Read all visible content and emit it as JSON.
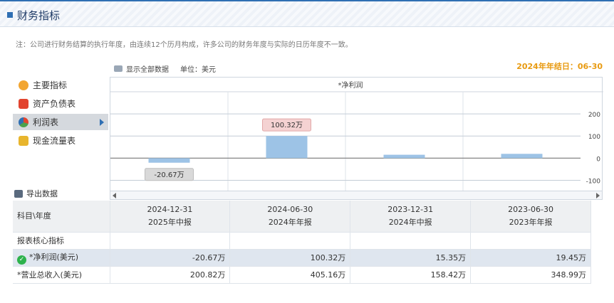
{
  "header": {
    "title": "财务指标"
  },
  "note": "注：公司进行财务结算的执行年度，由连续12个历月构成，许多公司的财务年度与实际的日历年度不一致。",
  "toolbar": {
    "show_all": "显示全部数据",
    "unit": "单位：美元"
  },
  "fiscal_year_end": "2024年年结日：06-30",
  "nav": [
    {
      "label": "主要指标",
      "icon": "gear-icon",
      "color": "#f2a531"
    },
    {
      "label": "资产负债表",
      "icon": "document-icon",
      "color": "#e2442f"
    },
    {
      "label": "利润表",
      "icon": "pie-chart-icon",
      "color": "#4aa14d"
    },
    {
      "label": "现金流量表",
      "icon": "coins-icon",
      "color": "#e8b52d"
    }
  ],
  "export_label": "导出数据",
  "chart_data": {
    "type": "bar",
    "title": "*净利润",
    "categories": [
      "2024-12-31",
      "2024-06-30",
      "2023-12-31",
      "2023-06-30"
    ],
    "values": [
      -20.67,
      100.32,
      15.35,
      19.45
    ],
    "data_labels": [
      "-20.67万",
      "100.32万",
      "",
      ""
    ],
    "ylim": [
      -150,
      300
    ],
    "yticks": [
      -100,
      0,
      100,
      200
    ],
    "ytick_labels": [
      "-100",
      "0",
      "100",
      "200"
    ],
    "bar_color": "#9dc3e6"
  },
  "table": {
    "corner": "科目\\年度",
    "columns": [
      {
        "date": "2024-12-31",
        "report": "2025年中报"
      },
      {
        "date": "2024-06-30",
        "report": "2024年年报"
      },
      {
        "date": "2023-12-31",
        "report": "2024年中报"
      },
      {
        "date": "2023-06-30",
        "report": "2023年年报"
      }
    ],
    "section": "报表核心指标",
    "rows": [
      {
        "label": "*净利润(美元)",
        "values": [
          "-20.67万",
          "100.32万",
          "15.35万",
          "19.45万"
        ]
      },
      {
        "label": "*营业总收入(美元)",
        "values": [
          "200.82万",
          "405.16万",
          "158.42万",
          "348.99万"
        ]
      }
    ]
  }
}
